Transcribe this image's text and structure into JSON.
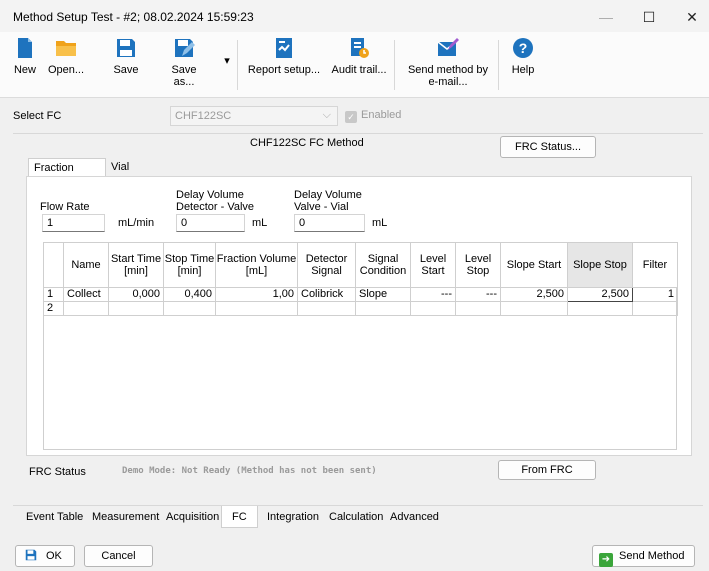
{
  "window": {
    "title": "Method Setup Test - #2;  08.02.2024  15:59:23",
    "minimize": "—",
    "maximize": "☐",
    "close": "✕"
  },
  "toolbar": {
    "new": "New",
    "open": "Open...",
    "save": "Save",
    "save_as": "Save as...",
    "save_as_arrow": "▾",
    "report_setup": "Report setup...",
    "audit_trail": "Audit trail...",
    "send_method_1": "Send method by",
    "send_method_2": "e-mail...",
    "help": "Help"
  },
  "select_fc": {
    "label": "Select FC",
    "value": "CHF122SC",
    "arrow": "⌵",
    "enabled_label": "Enabled",
    "enabled_check": "✓"
  },
  "method": {
    "title": "CHF122SC FC Method",
    "frc_status_button": "FRC Status..."
  },
  "inner_tabs": {
    "fraction_table": "Fraction Table",
    "vial_numbers": "Vial Numbers"
  },
  "fields": {
    "flow_rate_label": "Flow Rate",
    "flow_rate_value": "1",
    "flow_rate_unit": "mL/min",
    "delay_dv_label_1": "Delay Volume",
    "delay_dv_label_2": "Detector - Valve",
    "delay_dv_value": "0",
    "delay_dv_unit": "mL",
    "delay_vv_label_1": "Delay Volume",
    "delay_vv_label_2": "Valve - Vial",
    "delay_vv_value": "0",
    "delay_vv_unit": "mL"
  },
  "table": {
    "headers": [
      "",
      "Name",
      "Start Time [min]",
      "Stop Time [min]",
      "Fraction Volume [mL]",
      "Detector Signal",
      "Signal Condition",
      "Level Start",
      "Level Stop",
      "Slope Start",
      "Slope Stop",
      "Filter"
    ],
    "rows": [
      [
        "1",
        "Collect",
        "0,000",
        "0,400",
        "1,00",
        "Colibrick",
        "Slope",
        "---",
        "---",
        "2,500",
        "2,500",
        "1"
      ],
      [
        "2",
        "",
        "",
        "",
        "",
        "",
        "",
        "",
        "",
        "",
        "",
        ""
      ]
    ]
  },
  "frc": {
    "status_label": "FRC Status",
    "status_message": "Demo Mode: Not Ready (Method has not been sent)",
    "from_frc_button": "From FRC"
  },
  "bottom_tabs": [
    "Event Table",
    "Measurement",
    "Acquisition",
    "FC",
    "Integration",
    "Calculation",
    "Advanced"
  ],
  "footer": {
    "ok": "OK",
    "cancel": "Cancel",
    "send_method": "Send Method"
  },
  "colors": {
    "accent": "#1e73be",
    "toolbar_bg": "#fbfbfb",
    "window_bg": "#f0f0f0",
    "ok_green": "#3aa53a"
  }
}
